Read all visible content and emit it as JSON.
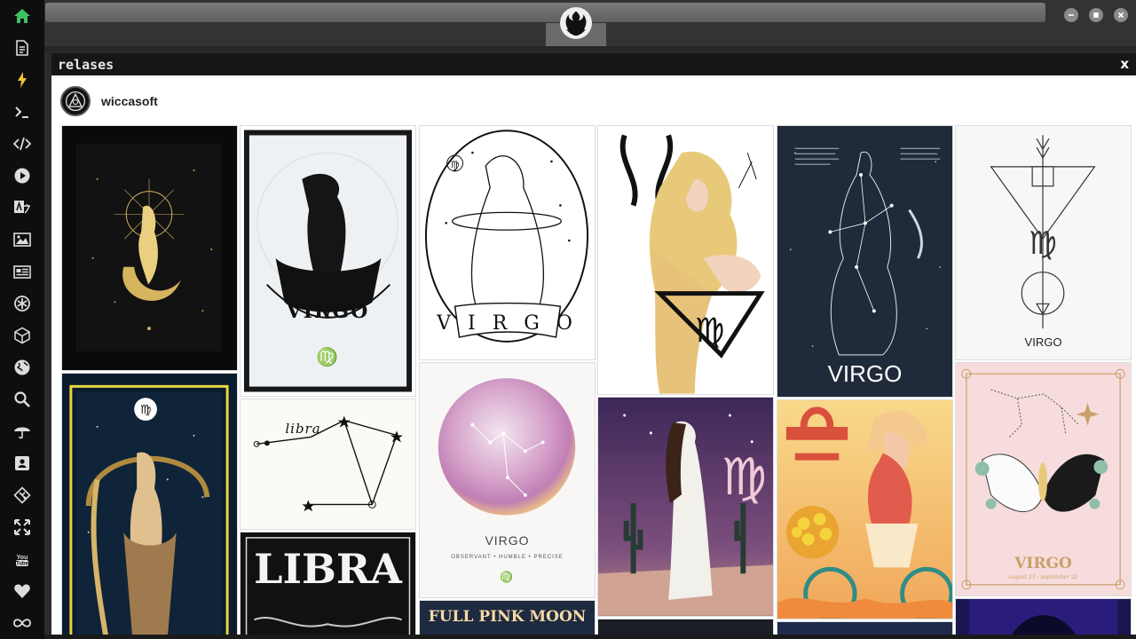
{
  "window": {
    "panel_title": "relases",
    "close_label": "x"
  },
  "profile": {
    "name": "wiccasoft"
  },
  "sidebar": {
    "icons": [
      "home-icon",
      "document-icon",
      "lightning-icon",
      "terminal-icon",
      "code-icon",
      "play-icon",
      "translate-icon",
      "image-icon",
      "news-icon",
      "settings-cog-icon",
      "cube-icon",
      "globe-icon",
      "search-icon",
      "umbrella-icon",
      "contact-icon",
      "git-icon",
      "expand-icon",
      "youtube-icon",
      "heart-icon",
      "infinity-icon"
    ],
    "active_color": "#3fbf5f"
  },
  "tiles": {
    "virgo_1": "VIRGO",
    "virgo_2": "V I R G O",
    "virgo_3": "VIRGO",
    "virgo_4": "VIRGO",
    "virgo_5": "VIRGO",
    "virgo_5_sub": "OBSERVANT • HUMBLE • PRECISE",
    "virgo_6": "VIRGO",
    "virgo_6_sub": "august 23 - september 22",
    "libra_script": "libra",
    "libra_title": "LIBRA",
    "moon_title": "FULL PINK MOON"
  },
  "colors": {
    "bg": "#2b2b2b",
    "rail": "#0e0e0e",
    "panel_header": "#161616"
  }
}
